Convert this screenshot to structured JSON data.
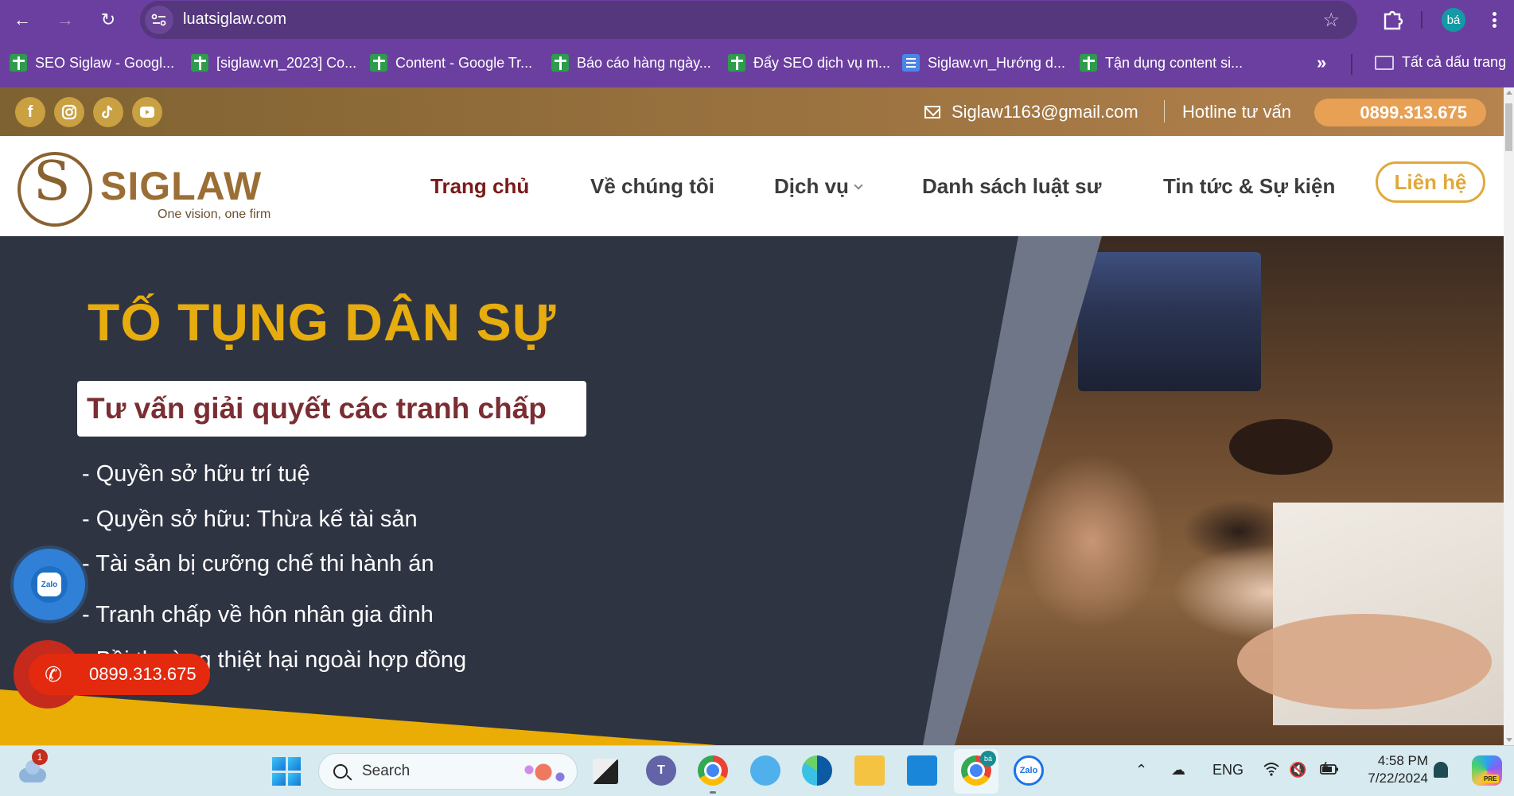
{
  "browser": {
    "url": "luatsiglaw.com",
    "profile_initials": "bá",
    "bookmarks": [
      {
        "label": "SEO Siglaw - Googl...",
        "icon": "sheets-icon"
      },
      {
        "label": "[siglaw.vn_2023] Co...",
        "icon": "sheets-icon"
      },
      {
        "label": "Content - Google Tr...",
        "icon": "sheets-icon"
      },
      {
        "label": "Báo cáo hàng ngày...",
        "icon": "sheets-icon"
      },
      {
        "label": "Đẩy SEO dịch vụ m...",
        "icon": "sheets-icon"
      },
      {
        "label": "Siglaw.vn_Hướng d...",
        "icon": "docs-icon"
      },
      {
        "label": "Tận dụng content si...",
        "icon": "sheets-icon"
      }
    ],
    "more_bookmarks": "»",
    "all_bookmarks": "Tất cả dấu trang"
  },
  "site": {
    "infobar": {
      "socials": [
        "facebook",
        "instagram",
        "tiktok",
        "youtube"
      ],
      "email": "Siglaw1163@gmail.com",
      "hotline_label": "Hotline tư vấn",
      "hotline_number": "0899.313.675"
    },
    "logo": {
      "mark": "S",
      "name": "SIGLAW",
      "tagline": "One vision, one firm"
    },
    "nav": [
      {
        "label": "Trang chủ",
        "active": true
      },
      {
        "label": "Về chúng tôi"
      },
      {
        "label": "Dịch vụ",
        "has_dropdown": true
      },
      {
        "label": "Danh sách luật sư"
      },
      {
        "label": "Tin tức & Sự kiện"
      }
    ],
    "contact_button": "Liên hệ",
    "hero": {
      "title": "TỐ TỤNG DÂN SỰ",
      "subtitle": "Tư vấn giải quyết các tranh chấp",
      "items": [
        "- Quyền sở hữu trí tuệ",
        "- Quyền sở hữu: Thừa kế tài sản",
        "- Tài sản bị cưỡng chế thi hành án",
        "- Tranh chấp về hôn nhân gia đình",
        "- Bồi thường thiệt hại ngoài hợp đồng"
      ]
    },
    "floating": {
      "zalo_label": "Zalo",
      "call_number": "0899.313.675"
    }
  },
  "taskbar": {
    "weather_badge": "1",
    "search_placeholder": "Search",
    "teams_letter": "T",
    "zalo_label": "Zalo",
    "chrome_badge": "bá",
    "language": "ENG",
    "time": "4:58 PM",
    "date": "7/22/2024",
    "copilot_badge": "PRE"
  },
  "colors": {
    "chrome_purple": "#6b3fa0",
    "omnibox": "#55377d",
    "infobar_gold": "#9b7340",
    "hotline_orange": "#e8a054",
    "nav_active": "#7a1a1a",
    "accent_gold": "#e0a93c",
    "hero_bg": "#2f3442",
    "hero_title": "#e7ac0d",
    "call_red": "#e32a0e",
    "zalo_blue": "#2f80d6"
  }
}
